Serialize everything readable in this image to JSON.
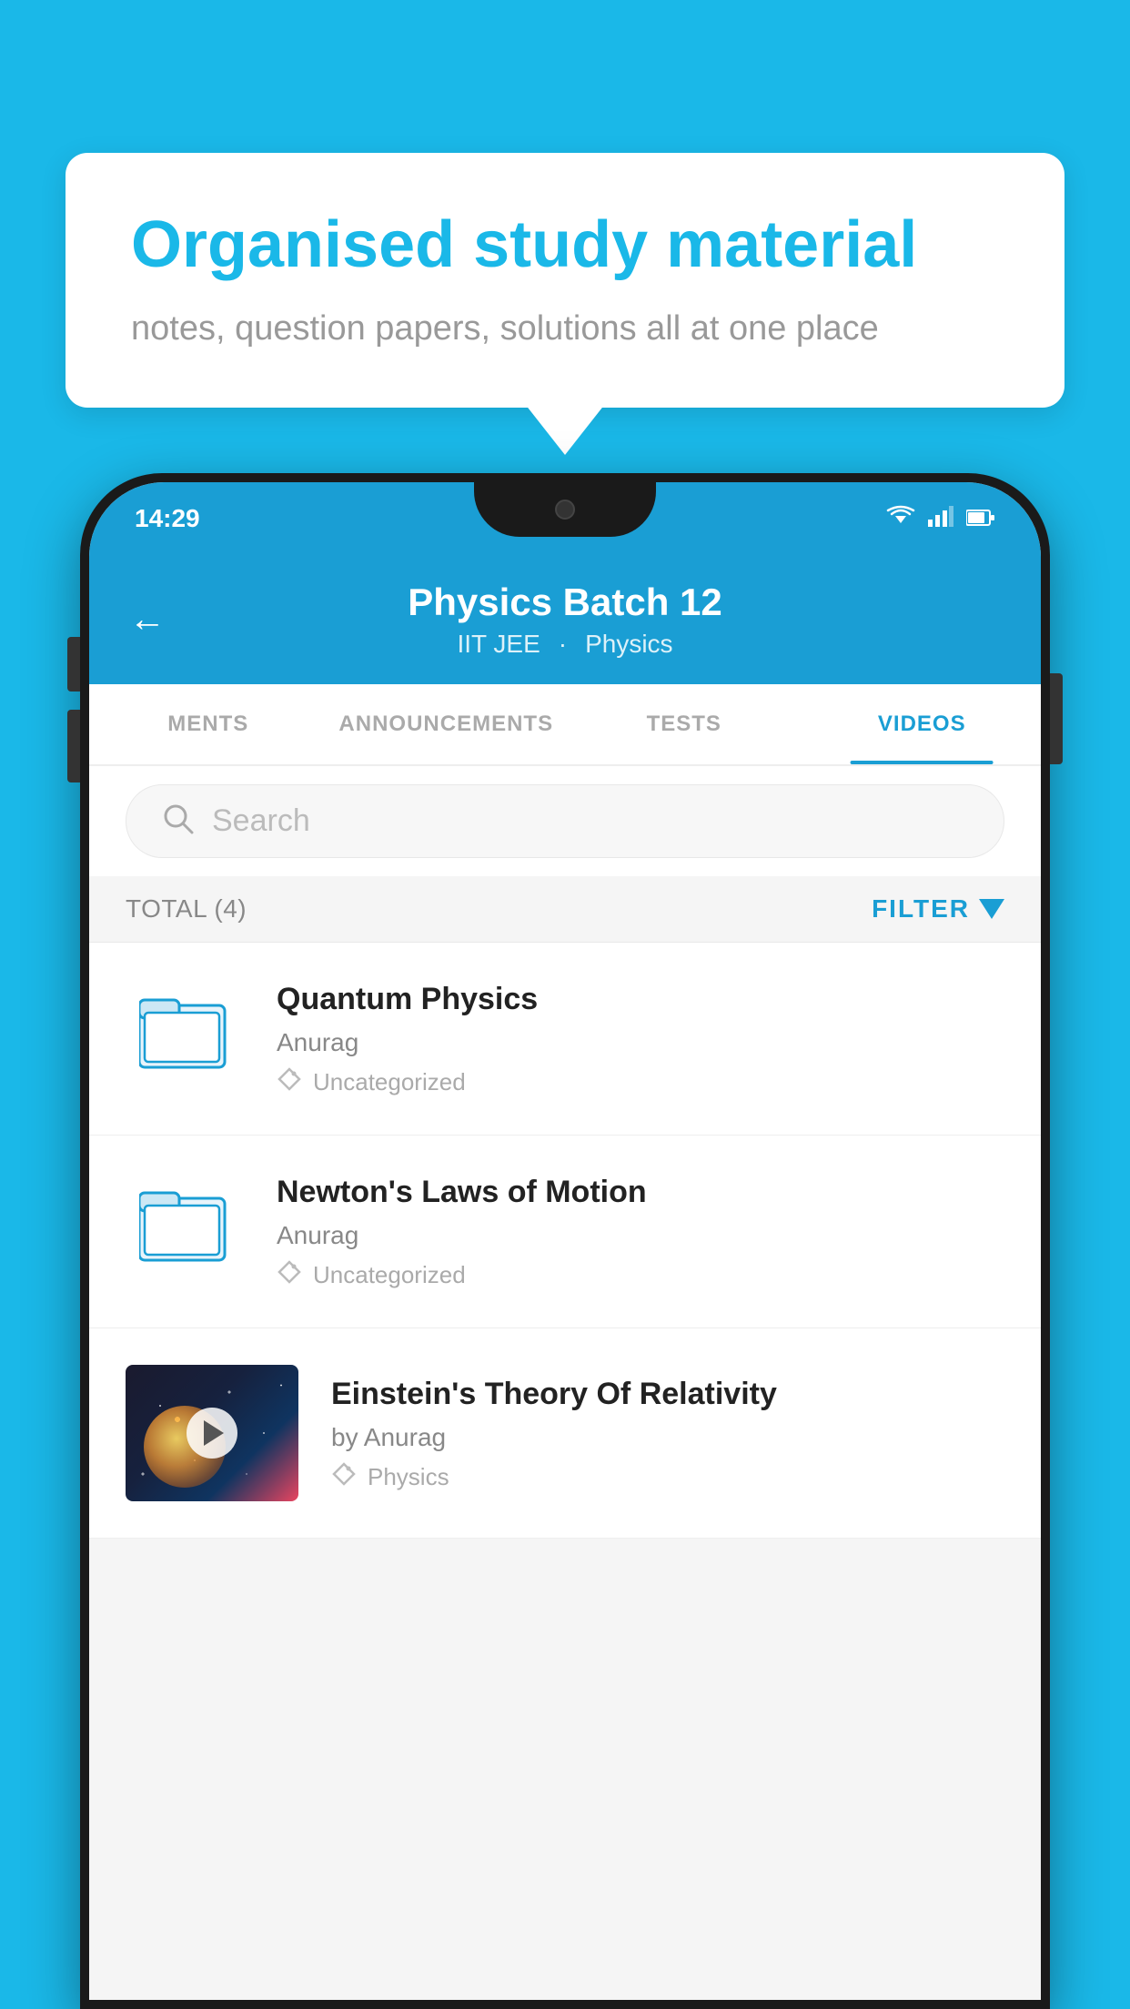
{
  "background_color": "#1ab8e8",
  "bubble": {
    "title": "Organised study material",
    "subtitle": "notes, question papers, solutions all at one place"
  },
  "phone": {
    "status_bar": {
      "time": "14:29",
      "wifi": "▼",
      "signal": "▲",
      "battery": "▐"
    },
    "header": {
      "back_label": "←",
      "title": "Physics Batch 12",
      "subtitle_left": "IIT JEE",
      "subtitle_right": "Physics"
    },
    "tabs": [
      {
        "label": "MENTS",
        "active": false
      },
      {
        "label": "ANNOUNCEMENTS",
        "active": false
      },
      {
        "label": "TESTS",
        "active": false
      },
      {
        "label": "VIDEOS",
        "active": true
      }
    ],
    "search": {
      "placeholder": "Search"
    },
    "filter": {
      "total_label": "TOTAL (4)",
      "filter_label": "FILTER"
    },
    "videos": [
      {
        "id": 1,
        "title": "Quantum Physics",
        "author": "Anurag",
        "tag": "Uncategorized",
        "has_thumbnail": false
      },
      {
        "id": 2,
        "title": "Newton's Laws of Motion",
        "author": "Anurag",
        "tag": "Uncategorized",
        "has_thumbnail": false
      },
      {
        "id": 3,
        "title": "Einstein's Theory Of Relativity",
        "author": "by Anurag",
        "tag": "Physics",
        "has_thumbnail": true
      }
    ]
  }
}
